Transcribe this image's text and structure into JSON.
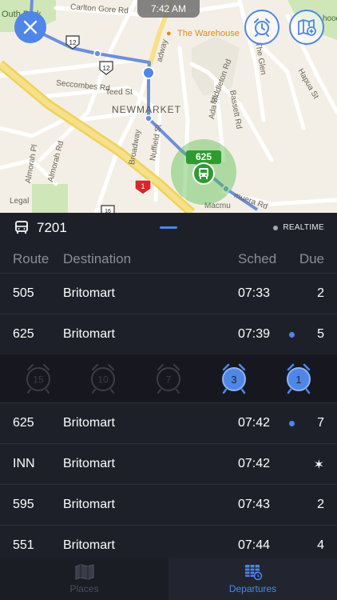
{
  "status_bar": {
    "time": "7:42 AM"
  },
  "map": {
    "labels": {
      "carlton_gore": "Carlton Gore Rd",
      "park": "Outh Park",
      "warehouse": "The Warehouse",
      "seccombes": "Seccombes Rd",
      "teed": "Teed St",
      "newmarket": "NEWMARKET",
      "broadway_top": "adway",
      "broadway": "Broadway",
      "nuffield": "Nuffield St",
      "middleton": "Middleton Rd",
      "ada": "Ada St",
      "bassett": "Bassett Rd",
      "glen": "The Glen",
      "hapua": "Hapua St",
      "almorah_pl": "Almorah Pl",
      "almorah_rd": "Almorah Rd",
      "remuera": "muera Rd",
      "macmu": "Macmu",
      "legal": "Legal",
      "hood": "hood"
    },
    "shields": {
      "route12a": "12",
      "route12b": "12",
      "route1": "1",
      "route16": "16"
    },
    "stop_badge": "625"
  },
  "stop": {
    "number": "7201",
    "realtime_label": "REALTIME"
  },
  "table": {
    "headers": {
      "route": "Route",
      "destination": "Destination",
      "sched": "Sched",
      "due": "Due"
    },
    "rows": [
      {
        "route": "505",
        "destination": "Britomart",
        "sched": "07:33",
        "due": "2",
        "realtime": false
      },
      {
        "route": "625",
        "destination": "Britomart",
        "sched": "07:39",
        "due": "5",
        "realtime": true
      },
      {
        "route": "625",
        "destination": "Britomart",
        "sched": "07:42",
        "due": "7",
        "realtime": true
      },
      {
        "route": "INN",
        "destination": "Britomart",
        "sched": "07:42",
        "due": "✶",
        "realtime": false
      },
      {
        "route": "595",
        "destination": "Britomart",
        "sched": "07:43",
        "due": "2",
        "realtime": false
      },
      {
        "route": "551",
        "destination": "Britomart",
        "sched": "07:44",
        "due": "4",
        "realtime": false
      }
    ]
  },
  "alarms": [
    {
      "minutes": "15",
      "active": false
    },
    {
      "minutes": "10",
      "active": false
    },
    {
      "minutes": "7",
      "active": false
    },
    {
      "minutes": "3",
      "active": true
    },
    {
      "minutes": "1",
      "active": true
    }
  ],
  "tabs": {
    "places": "Places",
    "departures": "Departures"
  },
  "colors": {
    "accent": "#4f86e8",
    "background": "#1e2029",
    "stop_green": "#2f9a2f"
  }
}
